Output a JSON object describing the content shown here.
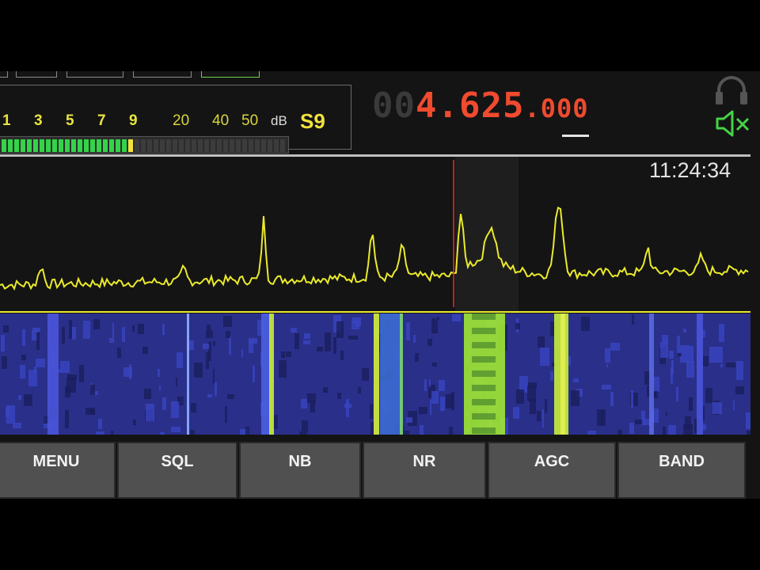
{
  "smeter": {
    "scale_labels": [
      "1",
      "3",
      "5",
      "7",
      "9"
    ],
    "db_labels": [
      "20",
      "40",
      "50"
    ],
    "db_unit": "dB",
    "s_value": "S9",
    "level_s_units": 9
  },
  "frequency": {
    "dim_digits": "00",
    "main": "4.625",
    "sub": ".000"
  },
  "clock": "11:24:34",
  "buttons": [
    {
      "label": "MENU"
    },
    {
      "label": "SQL"
    },
    {
      "label": "NB"
    },
    {
      "label": "NR"
    },
    {
      "label": "AGC"
    },
    {
      "label": "BAND"
    }
  ],
  "colors": {
    "trace": "#eaea2c",
    "frequency": "#f04a2f",
    "s_value": "#f2e23c",
    "meter_fill": "#34d34a",
    "tuning_marker": "#e03030",
    "speaker_icon": "#45d345"
  },
  "icons": [
    "headphones-icon",
    "speaker-muted-icon"
  ]
}
